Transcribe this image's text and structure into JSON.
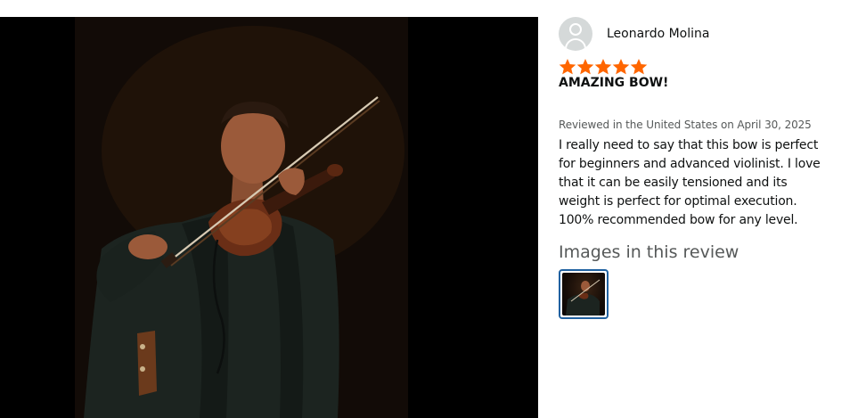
{
  "reviewer": {
    "name": "Leonardo Molina"
  },
  "rating": {
    "stars": 5,
    "max": 5,
    "color": "#FF6600"
  },
  "review": {
    "headline": "AMAZING BOW!",
    "meta": "Reviewed in the United States on April 30, 2025",
    "lines": [
      "I really need to say that this bow is perfect",
      "for beginners and advanced violinist. I love",
      "that it can be easily tensioned and its",
      "weight is perfect for optimal execution.",
      "100% recommended bow for any level."
    ]
  },
  "images_section": {
    "title": "Images in this review",
    "selected_thumb_border": "#2162A1"
  },
  "icons": {
    "avatar": "default-avatar-icon",
    "star": "star-icon"
  }
}
